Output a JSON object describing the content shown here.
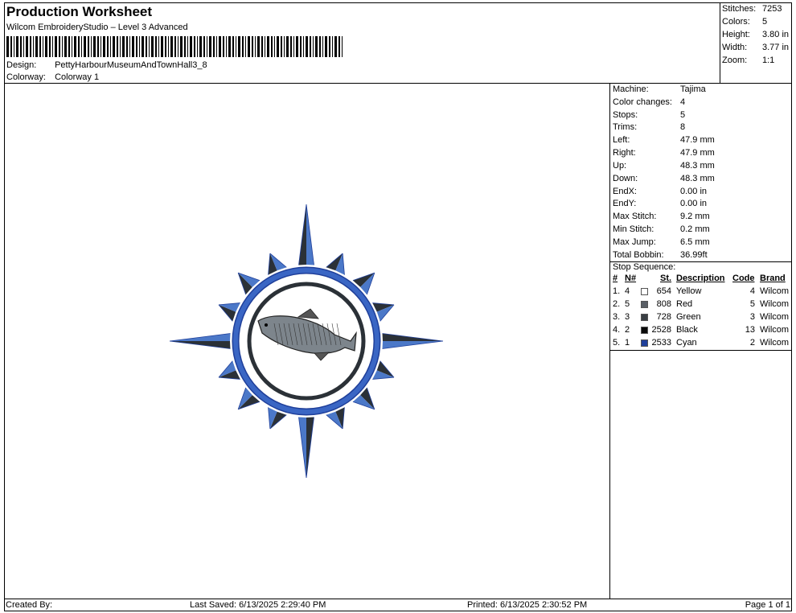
{
  "header": {
    "title": "Production Worksheet",
    "software": "Wilcom EmbroideryStudio – Level 3 Advanced",
    "design_label": "Design:",
    "design_value": "PettyHarbourMuseumAndTownHall3_8",
    "colorway_label": "Colorway:",
    "colorway_value": "Colorway 1"
  },
  "summary": [
    {
      "label": "Stitches:",
      "value": "7253"
    },
    {
      "label": "Colors:",
      "value": "5"
    },
    {
      "label": "Height:",
      "value": "3.80 in"
    },
    {
      "label": "Width:",
      "value": "3.77 in"
    },
    {
      "label": "Zoom:",
      "value": "1:1"
    }
  ],
  "info": [
    {
      "label": "Machine:",
      "value": "Tajima"
    },
    {
      "label": "Color changes:",
      "value": "4"
    },
    {
      "label": "Stops:",
      "value": "5"
    },
    {
      "label": "Trims:",
      "value": "8"
    },
    {
      "label": "Left:",
      "value": "47.9 mm"
    },
    {
      "label": "Right:",
      "value": "47.9 mm"
    },
    {
      "label": "Up:",
      "value": "48.3 mm"
    },
    {
      "label": "Down:",
      "value": "48.3 mm"
    },
    {
      "label": "EndX:",
      "value": "0.00 in"
    },
    {
      "label": "EndY:",
      "value": "0.00 in"
    },
    {
      "label": "Max Stitch:",
      "value": "9.2 mm"
    },
    {
      "label": "Min Stitch:",
      "value": "0.2 mm"
    },
    {
      "label": "Max Jump:",
      "value": "6.5 mm"
    },
    {
      "label": "Total Bobbin:",
      "value": "36.99ft"
    }
  ],
  "stop_sequence": {
    "title": "Stop Sequence:",
    "headers": {
      "num": "#",
      "n": "N#",
      "st": "St.",
      "desc": "Description",
      "code": "Code",
      "brand": "Brand"
    },
    "rows": [
      {
        "num": "1.",
        "n": "4",
        "color": "#ffffff",
        "st": "654",
        "desc": "Yellow",
        "code": "4",
        "brand": "Wilcom"
      },
      {
        "num": "2.",
        "n": "5",
        "color": "#5a5f66",
        "st": "808",
        "desc": "Red",
        "code": "5",
        "brand": "Wilcom"
      },
      {
        "num": "3.",
        "n": "3",
        "color": "#3a3f44",
        "st": "728",
        "desc": "Green",
        "code": "3",
        "brand": "Wilcom"
      },
      {
        "num": "4.",
        "n": "2",
        "color": "#0a0a0a",
        "st": "2528",
        "desc": "Black",
        "code": "13",
        "brand": "Wilcom"
      },
      {
        "num": "5.",
        "n": "1",
        "color": "#1f3f9a",
        "st": "2533",
        "desc": "Cyan",
        "code": "2",
        "brand": "Wilcom"
      }
    ]
  },
  "footer": {
    "created_by": "Created By:",
    "last_saved": "Last Saved: 6/13/2025 2:29:40 PM",
    "printed": "Printed: 6/13/2025 2:30:52 PM",
    "page": "Page 1 of 1"
  },
  "design": {
    "image_name": "compass-rose-fish-icon",
    "ring_color": "#3a66c4",
    "point_dark": "#2b3137",
    "point_light": "#4b78c8"
  }
}
